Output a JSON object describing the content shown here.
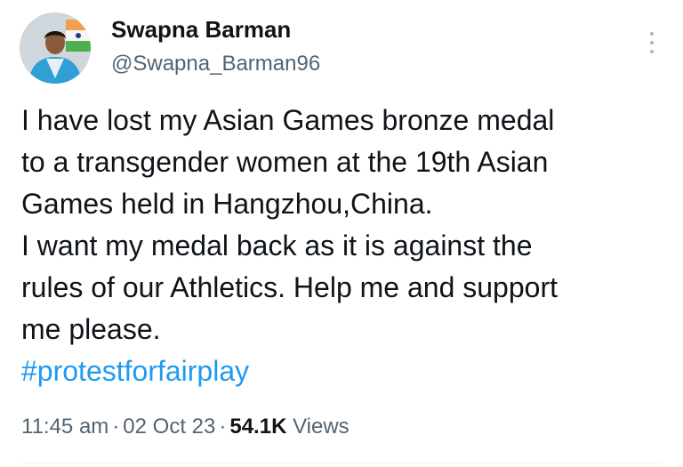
{
  "user": {
    "display_name": "Swapna Barman",
    "handle": "@Swapna_Barman96"
  },
  "tweet": {
    "text": "I have lost my Asian Games bronze medal\nto a transgender women at the 19th Asian\nGames held in Hangzhou,China.\nI want my medal back as it is against the\nrules of our Athletics. Help me and support\nme please.",
    "hashtag": "#protestforfairplay",
    "time": "11:45 am",
    "date": "02 Oct 23",
    "separator": "·",
    "views_count": "54.1K",
    "views_label": "Views"
  },
  "icons": {
    "more": "more-vertical-icon",
    "avatar": "avatar-photo"
  },
  "colors": {
    "text_primary": "#0f1419",
    "text_secondary": "#536471",
    "link": "#1d9bf0",
    "background": "#ffffff"
  }
}
